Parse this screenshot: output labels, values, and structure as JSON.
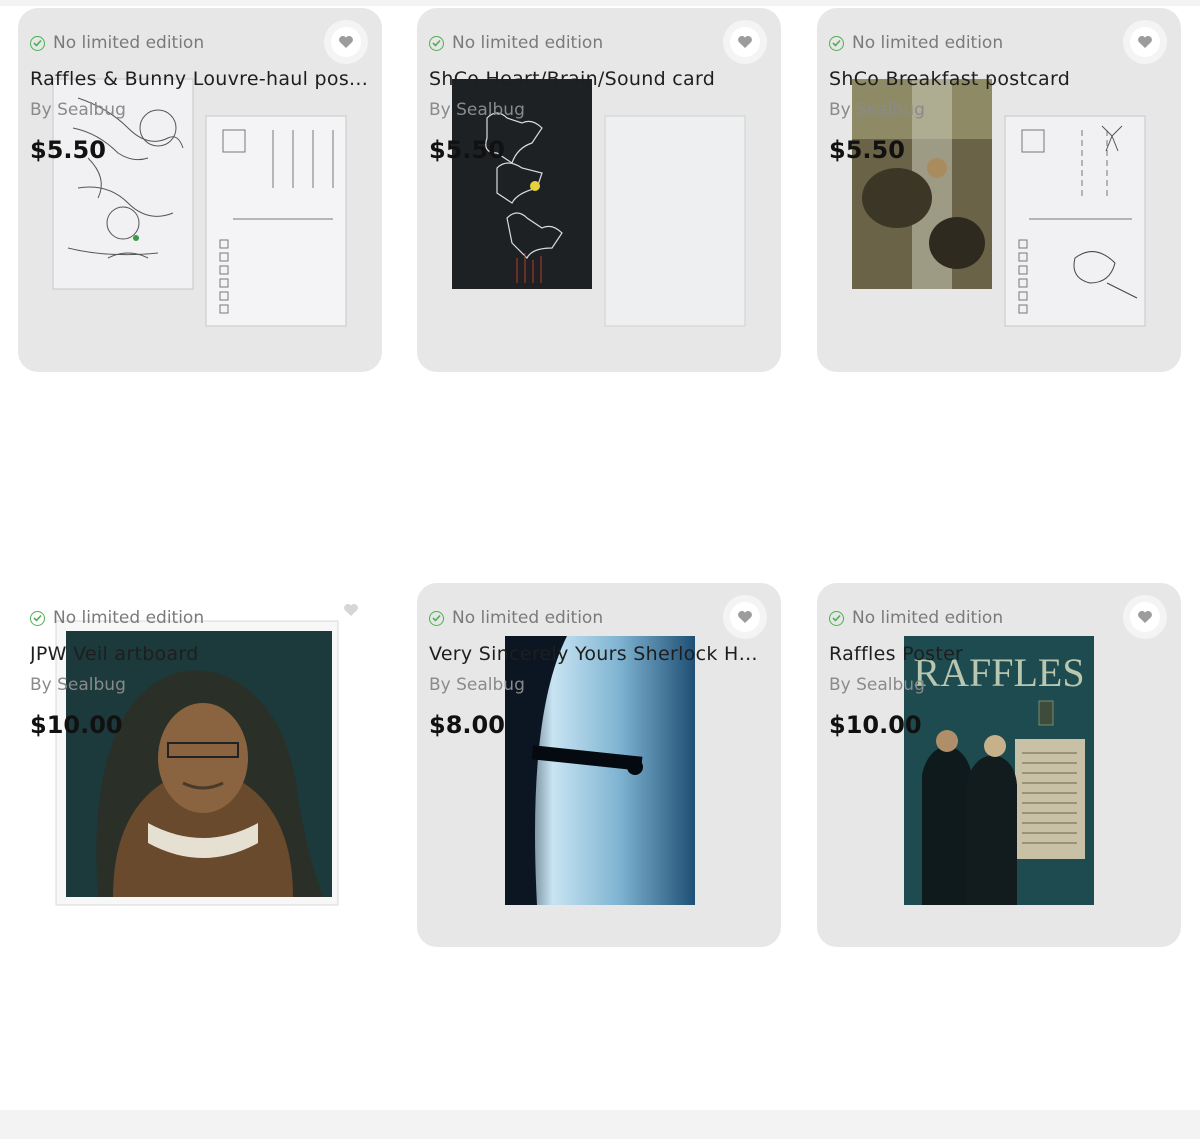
{
  "products": [
    {
      "badge": "No limited edition",
      "title": "Raffles & Bunny Louvre-haul pos...",
      "by": "By Sealbug",
      "price": "$5.50"
    },
    {
      "badge": "No limited edition",
      "title": "ShCo Heart/Brain/Sound card",
      "by": "By Sealbug",
      "price": "$5.50"
    },
    {
      "badge": "No limited edition",
      "title": "ShCo Breakfast postcard",
      "by": "By Sealbug",
      "price": "$5.50"
    },
    {
      "badge": "No limited edition",
      "title": "JPW Veil artboard",
      "by": "By Sealbug",
      "price": "$10.00"
    },
    {
      "badge": "No limited edition",
      "title": "Very Sincerely Yours Sherlock Ho...",
      "by": "By Sealbug",
      "price": "$8.00"
    },
    {
      "badge": "No limited edition",
      "title": "Raffles Poster",
      "by": "By Sealbug",
      "price": "$10.00"
    }
  ],
  "artwork": {
    "poster_title": "RAFFLES"
  },
  "icons": {
    "favorite": "heart-icon",
    "badge": "check-circle-icon"
  },
  "colors": {
    "card_bg": "#e7e7e7",
    "check_green": "#4caf50",
    "muted_text": "#8a8a8a"
  }
}
